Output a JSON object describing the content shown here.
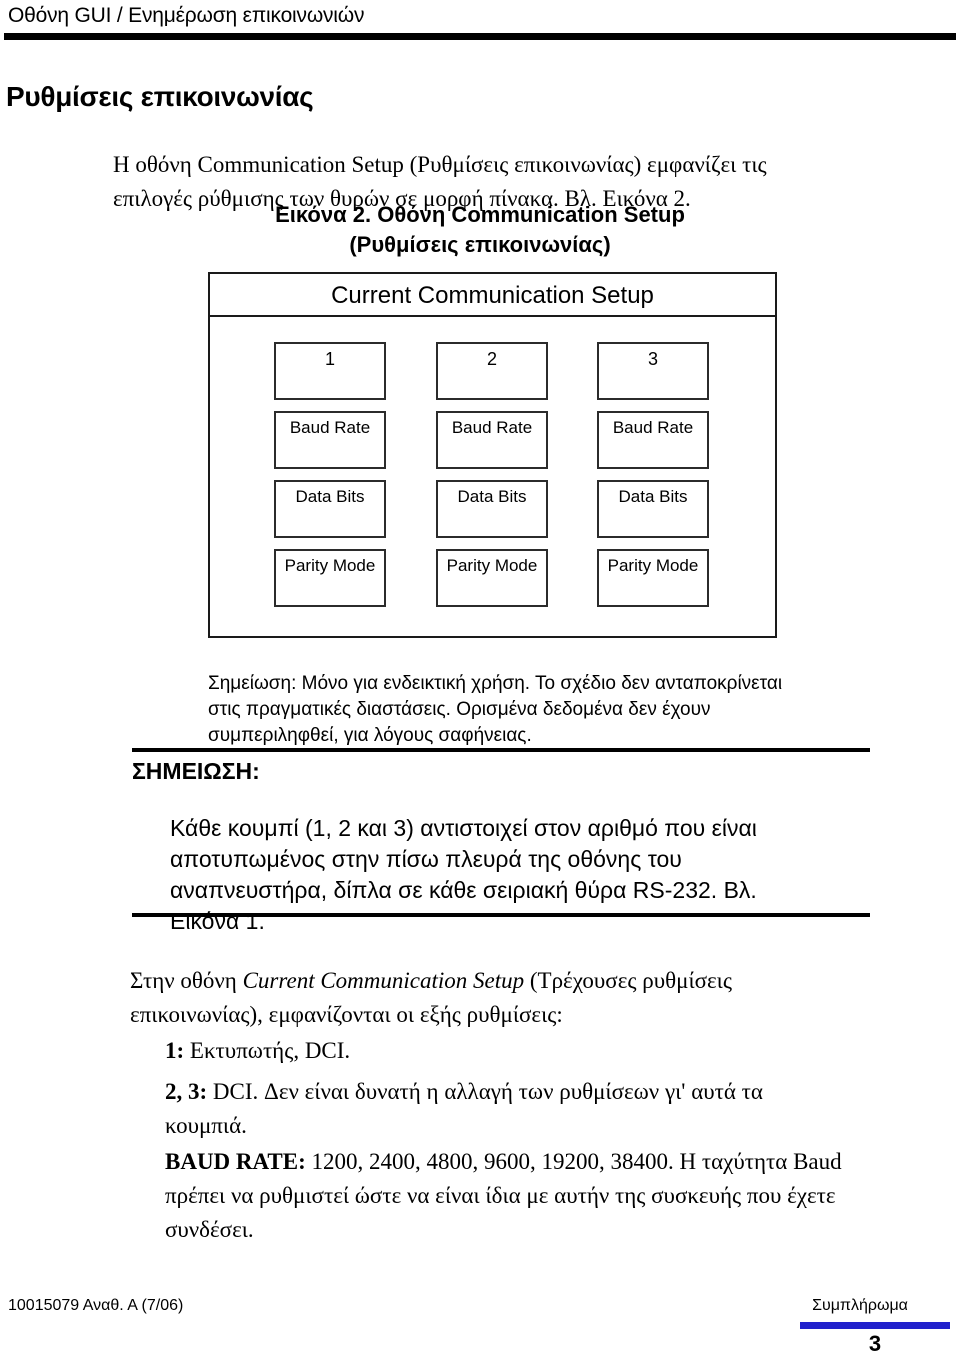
{
  "running_head": "Οθόνη GUI / Ενημέρωση επικοινωνιών",
  "page_title": "Ρυθμίσεις επικοινωνίας",
  "intro_paragraph": "Η οθόνη Communication Setup (Ρυθμίσεις επικοινωνίας) εμφανίζει τις επιλογές ρύθμισης των θυρών σε μορφή πίνακα. Βλ. Εικόνα 2.",
  "figure": {
    "caption_line1": "Εικόνα 2.  Οθόνη Communication Setup",
    "caption_line2": "(Ρυθμίσεις επικοινωνίας)",
    "screen_title": "Current Communication Setup",
    "columns": [
      {
        "port": "1",
        "rows": [
          "Baud Rate",
          "Data Bits",
          "Parity Mode"
        ]
      },
      {
        "port": "2",
        "rows": [
          "Baud Rate",
          "Data Bits",
          "Parity Mode"
        ]
      },
      {
        "port": "3",
        "rows": [
          "Baud Rate",
          "Data Bits",
          "Parity Mode"
        ]
      }
    ],
    "note": "Σημείωση: Μόνο για ενδεικτική χρήση. Το σχέδιο δεν ανταποκρίνεται στις πραγματικές διαστάσεις. Ορισμένα δεδομένα δεν έχουν συμπεριληφθεί, για λόγους σαφήνειας."
  },
  "note_block": {
    "label": "ΣΗΜΕΙΩΣΗ:",
    "text": "Κάθε κουμπί (1, 2 και 3) αντιστοιχεί στον αριθμό που είναι αποτυπωμένος στην πίσω πλευρά της οθόνης του αναπνευστήρα, δίπλα σε κάθε σειριακή θύρα RS-232. Βλ. Εικόνα 1."
  },
  "settings_section": {
    "lead_before_italic": "Στην οθόνη ",
    "lead_italic": "Current Communication Setup",
    "lead_after_italic": " (Τρέχουσες ρυθμίσεις επικοινωνίας), εμφανίζονται οι εξής ρυθμίσεις:",
    "item1_label": "1:",
    "item1_text": " Εκτυπωτής, DCI.",
    "item23_label": "2, 3:",
    "item23_text": " DCI. Δεν είναι δυνατή η αλλαγή των ρυθμίσεων γι' αυτά τα κουμπιά.",
    "baud_label": "BAUD RATE:",
    "baud_text": " 1200, 2400, 4800, 9600, 19200, 38400. Η ταχύτητα Baud πρέπει να ρυθμιστεί ώστε να είναι ίδια με αυτήν της συσκευής που έχετε συνδέσει."
  },
  "footer": {
    "document_id": "10015079 Αναθ. Α (7/06)",
    "section_label": "Συμπλήρωμα",
    "page_number": "3",
    "accent_color": "#2121cc"
  }
}
